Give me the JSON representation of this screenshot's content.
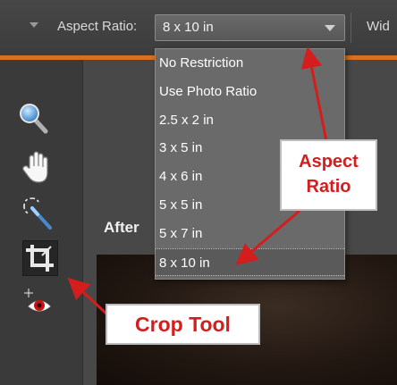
{
  "options_bar": {
    "aspect_label": "Aspect Ratio:",
    "aspect_value": "8 x 10 in",
    "width_label_partial": "Wid"
  },
  "dropdown": {
    "options": [
      "No Restriction",
      "Use Photo Ratio",
      "2.5 x 2 in",
      "3 x 5 in",
      "4 x 6 in",
      "5 x 5 in",
      "5 x 7 in",
      "8 x 10 in"
    ],
    "selected": "8 x 10 in"
  },
  "canvas": {
    "view_label": "After"
  },
  "toolbox": {
    "tools": [
      "zoom-icon",
      "hand-icon",
      "quick-selection-icon",
      "crop-icon",
      "red-eye-removal-icon"
    ],
    "active": "crop-icon"
  },
  "annotations": {
    "aspect_ratio_line1": "Aspect",
    "aspect_ratio_line2": "Ratio",
    "crop_tool": "Crop Tool"
  },
  "colors": {
    "accent_orange": "#d8701f",
    "callout_text": "#d41d1d",
    "arrow": "#d41d1d"
  }
}
